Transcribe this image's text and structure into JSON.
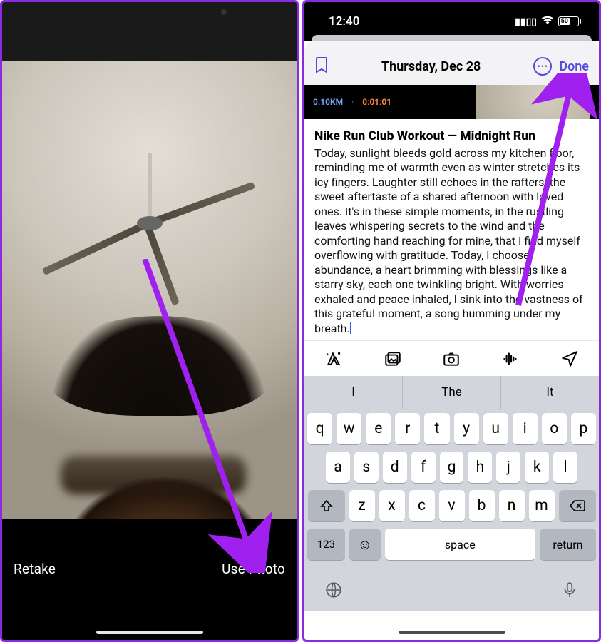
{
  "left": {
    "retake_label": "Retake",
    "use_photo_label": "Use Photo"
  },
  "right": {
    "status": {
      "time": "12:40",
      "battery_pct": "50"
    },
    "nav": {
      "title": "Thursday, Dec 28",
      "done_label": "Done"
    },
    "workout": {
      "distance": "0.10KM",
      "sep": "·",
      "time": "0:01:01"
    },
    "entry": {
      "title": "Nike Run Club Workout — Midnight Run",
      "body": "Today, sunlight bleeds gold across my kitchen floor, reminding me of warmth even as winter stretches its icy fingers. Laughter still echoes in the rafters, the sweet aftertaste of a shared afternoon with loved ones. It's in these simple moments, in the rustling leaves whispering secrets to the wind and the comforting hand reaching for mine, that I find myself overflowing with gratitude. Today, I choose abundance, a heart brimming with blessings like a starry sky, each one twinkling bright. With worries exhaled and peace inhaled, I sink into the vastness of this grateful moment, a song humming under my breath."
    },
    "suggestions": [
      "I",
      "The",
      "It"
    ],
    "keyboard": {
      "row1": [
        "q",
        "w",
        "e",
        "r",
        "t",
        "y",
        "u",
        "i",
        "o",
        "p"
      ],
      "row2": [
        "a",
        "s",
        "d",
        "f",
        "g",
        "h",
        "j",
        "k",
        "l"
      ],
      "row3": [
        "z",
        "x",
        "c",
        "v",
        "b",
        "n",
        "m"
      ],
      "num_label": "123",
      "space_label": "space",
      "return_label": "return"
    }
  }
}
